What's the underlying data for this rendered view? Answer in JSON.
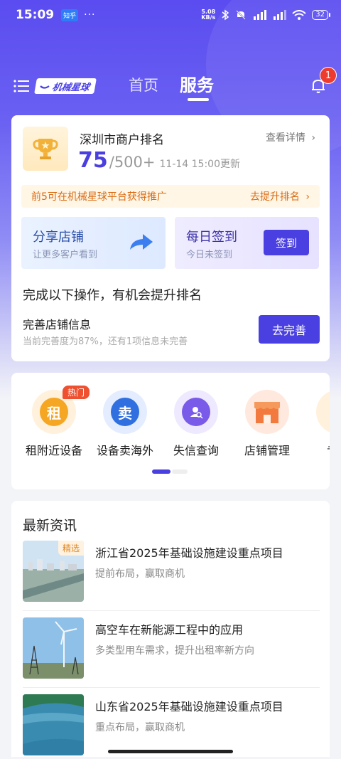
{
  "status_bar": {
    "time": "15:09",
    "app_badge": "知乎",
    "dots": "···",
    "net_speed_value": "5.08",
    "net_speed_unit": "KB/s",
    "battery": "32"
  },
  "nav": {
    "logo_text": "机械星球",
    "tabs": [
      {
        "label": "首页"
      },
      {
        "label": "服务"
      }
    ],
    "active_tab": "服务",
    "notification_count": "1"
  },
  "rank": {
    "title": "深圳市商户排名",
    "detail_link": "查看详情",
    "value": "75",
    "total": "/500+",
    "updated": "11-14 15:00更新",
    "promo_text": "前5可在机械星球平台获得推广",
    "promo_link": "去提升排名"
  },
  "share": {
    "title": "分享店铺",
    "subtitle": "让更多客户看到"
  },
  "sign_in": {
    "title": "每日签到",
    "subtitle": "今日未签到",
    "button": "签到"
  },
  "tasks": {
    "heading": "完成以下操作，有机会提升排名",
    "item_name": "完善店铺信息",
    "item_desc": "当前完善度为87%，还有1项信息未完善",
    "item_button": "去完善"
  },
  "services": {
    "items": [
      {
        "label": "租附近设备",
        "glyph": "租",
        "badge": "热门",
        "color": "#f5a623"
      },
      {
        "label": "设备卖海外",
        "glyph": "卖",
        "color": "#2f6fe0"
      },
      {
        "label": "失信查询",
        "glyph": "",
        "color": "#7a5ae8"
      },
      {
        "label": "店铺管理",
        "glyph": "",
        "color": "#f27a3e"
      },
      {
        "label": "专属",
        "glyph": "",
        "color": "#f5a623"
      }
    ],
    "page_index": 0,
    "page_count": 2
  },
  "news": {
    "heading": "最新资讯",
    "items": [
      {
        "headline": "浙江省2025年基础设施建设重点项目",
        "sub": "提前布局，赢取商机",
        "tag": "精选"
      },
      {
        "headline": "高空车在新能源工程中的应用",
        "sub": "多类型用车需求，提升出租率新方向"
      },
      {
        "headline": "山东省2025年基础设施建设重点项目",
        "sub": "重点布局，赢取商机"
      }
    ]
  },
  "colors": {
    "brand": "#4a3fe0",
    "promo_text": "#d86a12",
    "badge_red": "#ee3b2f"
  }
}
